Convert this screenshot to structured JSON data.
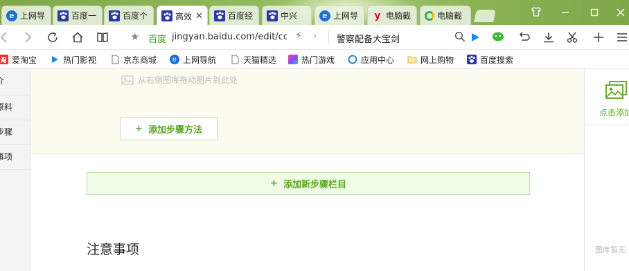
{
  "tabs": [
    {
      "title": "上网导",
      "favicon": "ie-icon",
      "active": false
    },
    {
      "title": "百度一",
      "favicon": "baidu-paw-icon",
      "active": false
    },
    {
      "title": "百度个",
      "favicon": "baidu-paw-icon",
      "active": false
    },
    {
      "title": "高效",
      "favicon": "baidu-paw-icon",
      "active": true
    },
    {
      "title": "百度经",
      "favicon": "baidu-paw-icon",
      "active": false
    },
    {
      "title": "中兴",
      "favicon": "baidu-paw-icon",
      "active": false
    },
    {
      "title": "上网导",
      "favicon": "ie-icon",
      "active": false
    },
    {
      "title": "电脑截",
      "favicon": "y-logo-icon",
      "active": false
    },
    {
      "title": "电脑截",
      "favicon": "green-circle-icon",
      "active": false
    }
  ],
  "toolbar": {
    "site_name": "百度",
    "url": "jingyan.baidu.com/edit/con",
    "search_text": "警察配备大宝剑"
  },
  "bookmarks": [
    {
      "label": "爱淘宝",
      "icon": "taobao-icon"
    },
    {
      "label": "热门影视",
      "icon": "play-icon"
    },
    {
      "label": "京东商城",
      "icon": "page-icon"
    },
    {
      "label": "上网导航",
      "icon": "ie-icon"
    },
    {
      "label": "天猫精选",
      "icon": "page-icon"
    },
    {
      "label": "热门游戏",
      "icon": "game-icon"
    },
    {
      "label": "应用中心",
      "icon": "app-center-icon"
    },
    {
      "label": "网上购物",
      "icon": "folder-icon"
    },
    {
      "label": "百度搜索",
      "icon": "baidu-paw-icon"
    }
  ],
  "leftnav": [
    "介",
    "原料",
    "步骤",
    "事项"
  ],
  "editor": {
    "image_hint": "从右侧图库拖动图片到此处",
    "add_method_label": "添加步骤方法",
    "add_step_label": "添加新步骤栏目",
    "notes_title": "注意事项"
  },
  "gallery": {
    "click_add_label": "点击添加",
    "empty_label": "图库暂无"
  },
  "colors": {
    "accent_green": "#5aa41f",
    "tab_bar_green": "#8bb356",
    "editor_bg": "#fbfcef",
    "add_step_bg": "#effde6"
  }
}
